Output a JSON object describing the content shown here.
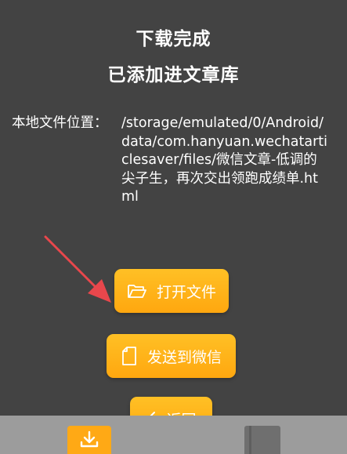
{
  "dialog": {
    "title": "下载完成",
    "subtitle": "已添加进文章库",
    "location_label": "本地文件位置：",
    "location_path": "/storage/emulated/0/Android/data/com.hanyuan.wechatarticlesaver/files/微信文章-低调的尖子生，再次交出领跑成绩单.html"
  },
  "buttons": {
    "open_file": "打开文件",
    "send_wechat": "发送到微信",
    "back": "返回"
  },
  "bottom_nav": {
    "items": [
      {
        "icon": "download-icon"
      },
      {
        "icon": "book-icon"
      }
    ]
  },
  "colors": {
    "background": "#434343",
    "accent": "#ffa915",
    "annotation_arrow": "#e8474c",
    "bottom_bar": "#9c9c9c"
  }
}
